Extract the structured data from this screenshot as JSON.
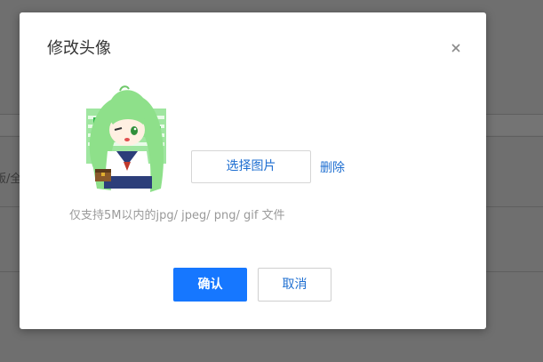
{
  "background": {
    "partial_text": "版/全"
  },
  "modal": {
    "title": "修改头像",
    "close_icon": "close-icon",
    "avatar_icon": "anime-avatar-image",
    "select_button_label": "选择图片",
    "delete_label": "删除",
    "hint_text": "仅支持5M以内的jpg/ jpeg/ png/ gif 文件",
    "confirm_label": "确认",
    "cancel_label": "取消"
  },
  "colors": {
    "primary": "#1677ff",
    "link": "#1f6fd1",
    "overlay": "#7e7e7e",
    "hint": "#9a9a9a"
  }
}
